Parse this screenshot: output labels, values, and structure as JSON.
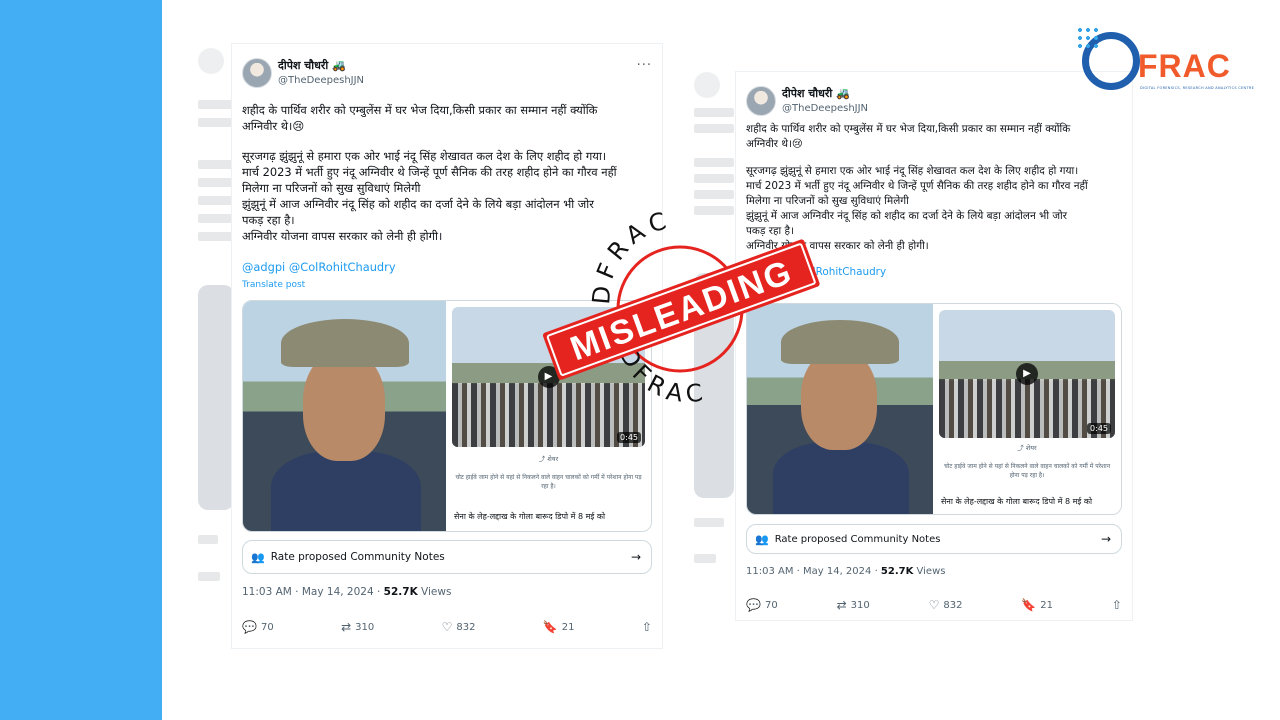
{
  "tweet": {
    "display_name": "दीपेश चौधरी 🚜",
    "handle": "@TheDeepeshJJN",
    "more": "···",
    "body_lines": [
      "शहीद के पार्थिव शरीर को एम्बुलेंस में घर भेज दिया,किसी प्रकार का सम्मान नहीं क्योंकि",
      "अग्निवीर थे।😢",
      "",
      "सूरजगढ़ झुंझुनूं से हमारा एक ओर भाई नंदू सिंह शेखावत कल देश के लिए शहीद हो गया।",
      "मार्च 2023 में भर्ती हुए नंदू अग्निवीर थे जिन्हें पूर्ण सैनिक की तरह शहीद होने का गौरव नहीं",
      "मिलेगा ना परिजनों को सुख सुविधाएं मिलेगी",
      " झुंझुनूं में आज अग्निवीर नंदू सिंह को शहीद का दर्जा देने के लिये बड़ा आंदोलन भी जोर",
      "पकड़ रहा है।",
      "अग्निवीर योजना वापस सरकार को लेनी ही होगी।"
    ],
    "mentions": "@adgpi @ColRohitChaudry",
    "translate": "Translate post",
    "video_duration": "0:45",
    "share_label": "शेयर",
    "caption_small": "चोट हाईवे जाम होने से यहां से निकलने वाले वाहन चालकों को गर्मी में परेशान होना पड़ रहा है।",
    "caption_big": "सेना के लेह-लद्दाख के गोला बारूद डिपो में 8 मई को",
    "community_notes": "Rate proposed Community Notes",
    "time": "11:03 AM · May 14, 2024 · ",
    "views_count": "52.7K",
    "views_label": " Views",
    "replies": "70",
    "reposts": "310",
    "likes": "832",
    "bookmarks": "21"
  },
  "logo": {
    "word": "FRAC",
    "tagline": "DIGITAL FORENSICS, RESEARCH AND ANALYTICS CENTRE"
  },
  "stamp": {
    "label": "MISLEADING",
    "top_text": "DFRAC",
    "bottom_text": "DFRAC"
  },
  "icons": {
    "reply": "reply-icon",
    "repost": "repost-icon",
    "like": "heart-icon",
    "bookmark": "bookmark-icon",
    "share": "share-icon",
    "notes": "people-icon",
    "arrow": "arrow-right-icon"
  },
  "colors": {
    "left_band": "#44aef5",
    "link": "#1d9bf0",
    "stamp_red": "#e5231f",
    "logo_orange": "#f15a2a",
    "logo_blue": "#1f5fae"
  }
}
